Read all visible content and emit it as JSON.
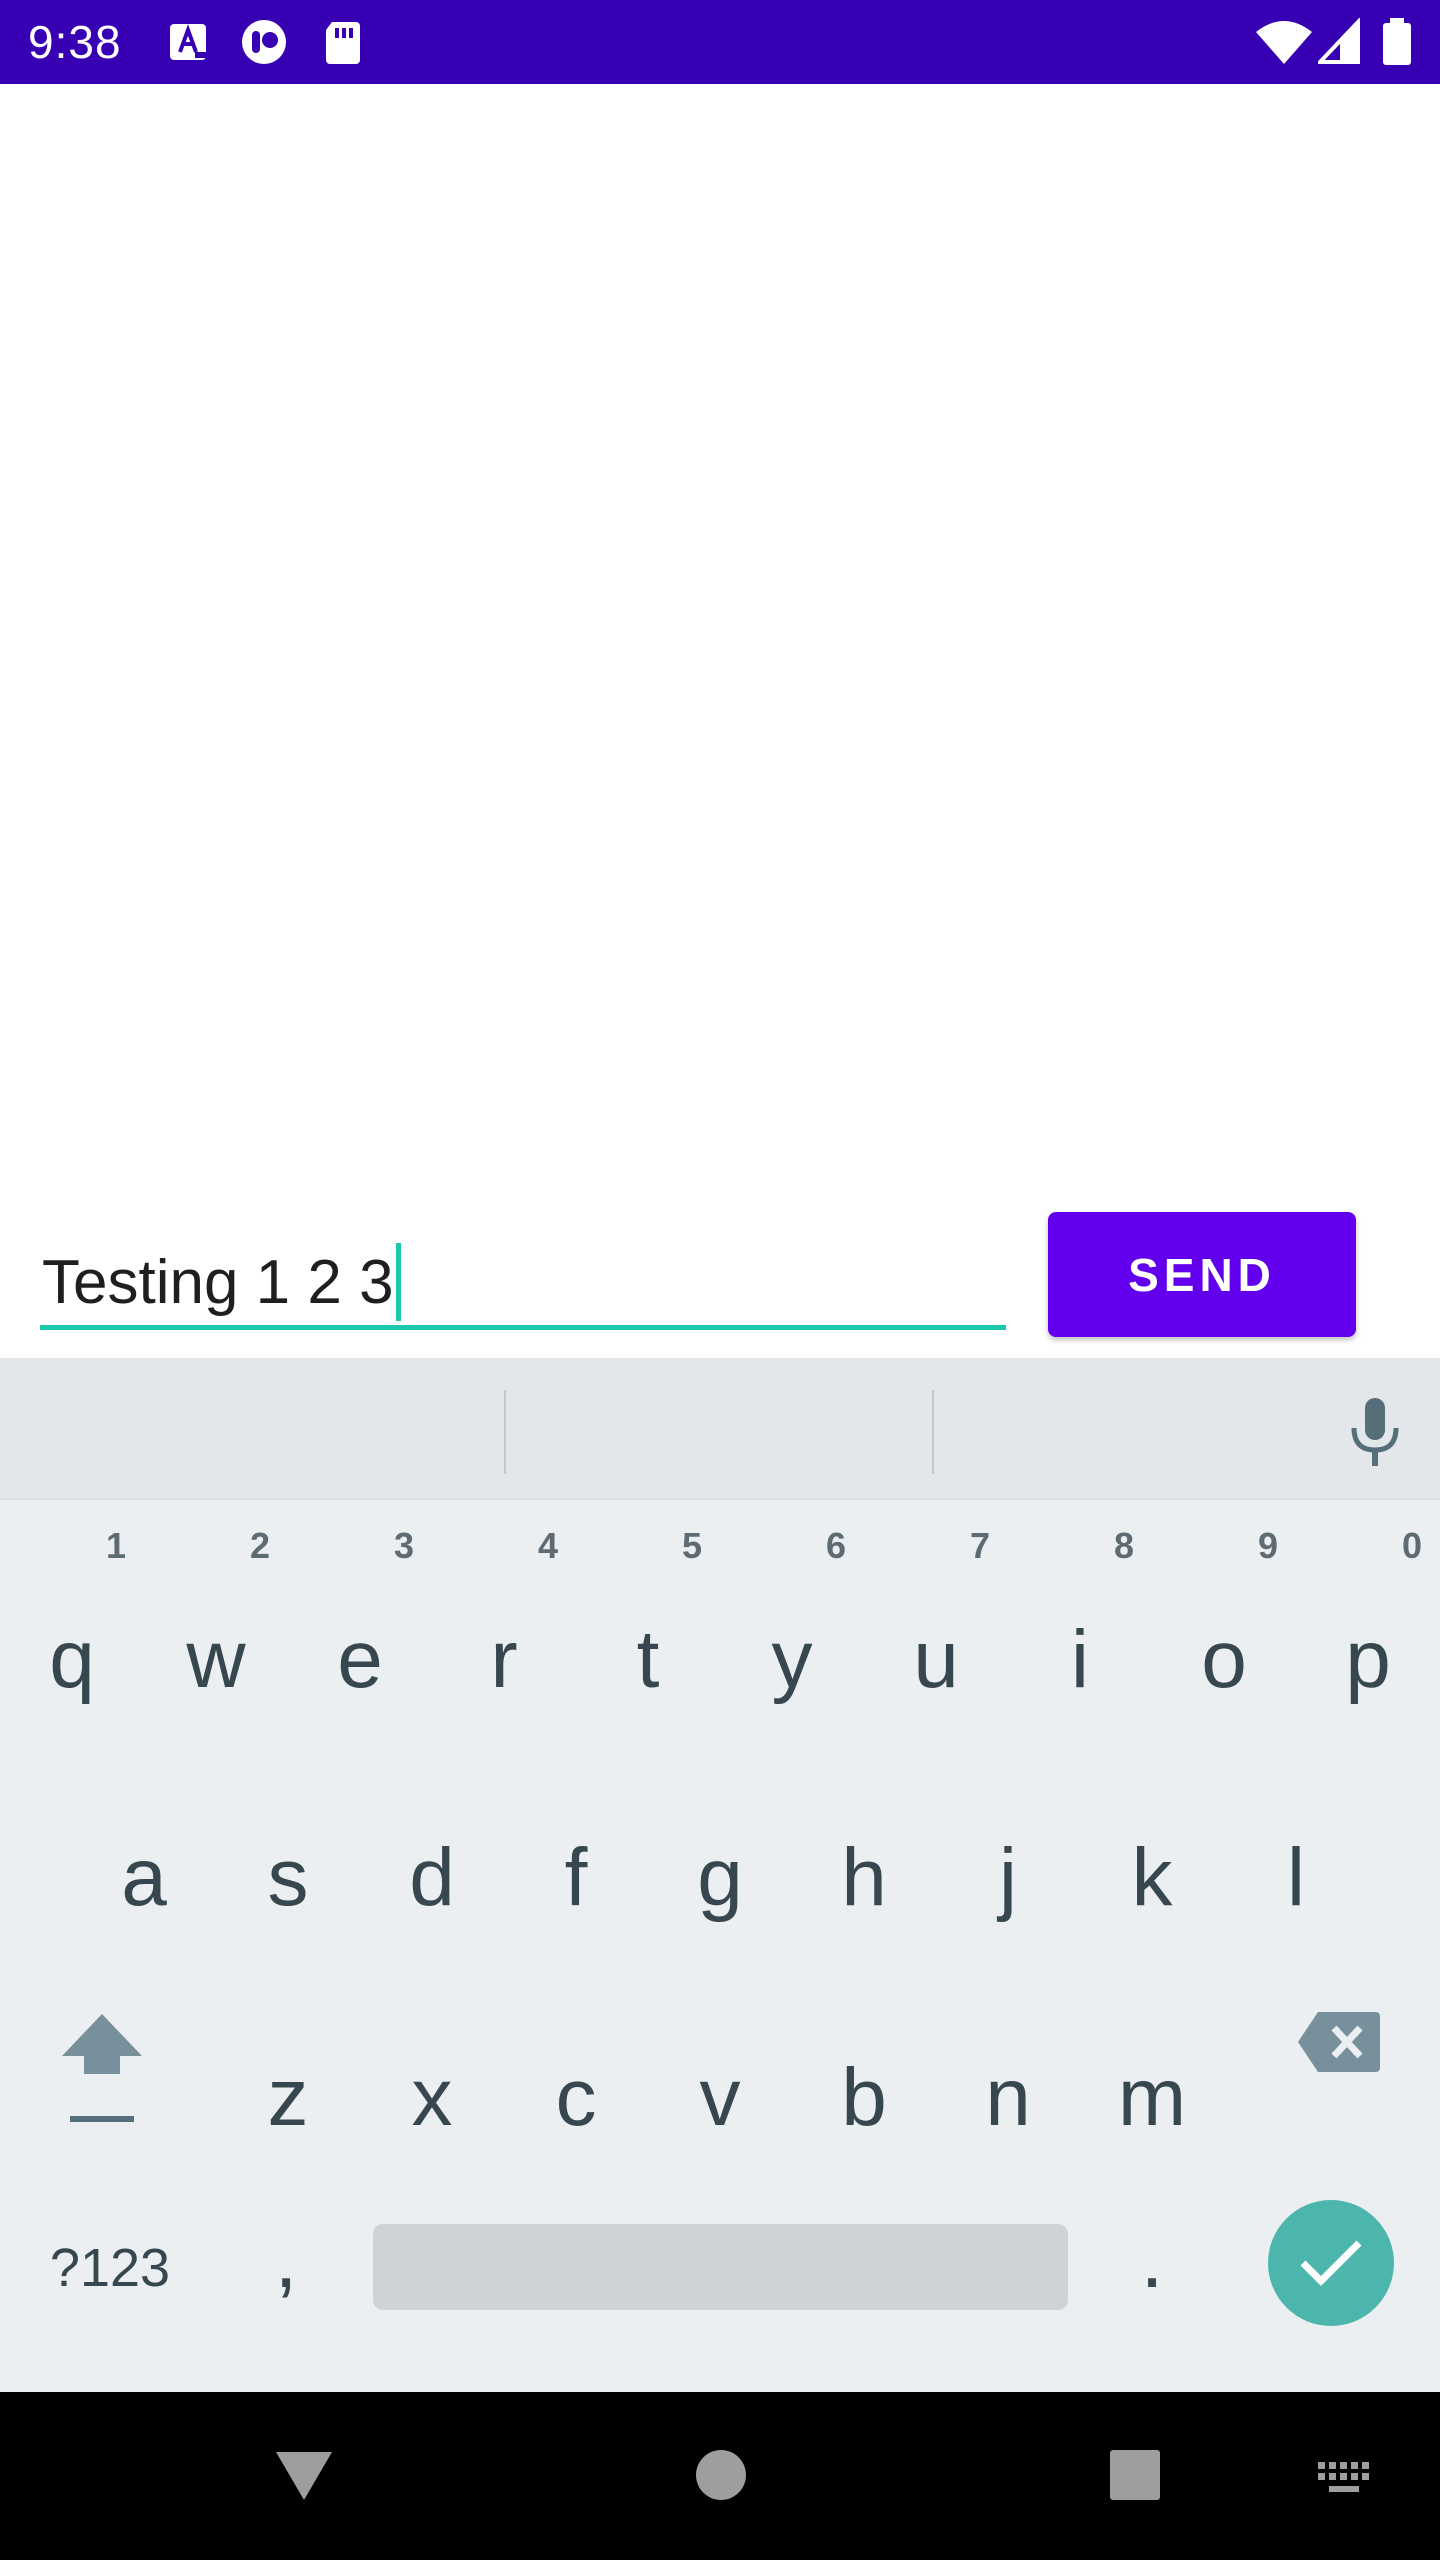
{
  "status_bar": {
    "time": "9:38",
    "left_icons": [
      "a-badge-icon",
      "toggle-app-icon",
      "sd-card-icon"
    ],
    "right_icons": [
      "wifi-icon",
      "signal-icon",
      "battery-icon"
    ],
    "background": "#3700b3"
  },
  "compose": {
    "input_value": "Testing 1 2 3",
    "accent": "#1bc7ad",
    "send_label": "SEND",
    "send_color": "#6200ee"
  },
  "keyboard": {
    "row1": [
      {
        "key": "q",
        "hint": "1"
      },
      {
        "key": "w",
        "hint": "2"
      },
      {
        "key": "e",
        "hint": "3"
      },
      {
        "key": "r",
        "hint": "4"
      },
      {
        "key": "t",
        "hint": "5"
      },
      {
        "key": "y",
        "hint": "6"
      },
      {
        "key": "u",
        "hint": "7"
      },
      {
        "key": "i",
        "hint": "8"
      },
      {
        "key": "o",
        "hint": "9"
      },
      {
        "key": "p",
        "hint": "0"
      }
    ],
    "row2": [
      "a",
      "s",
      "d",
      "f",
      "g",
      "h",
      "j",
      "k",
      "l"
    ],
    "row3": [
      "z",
      "x",
      "c",
      "v",
      "b",
      "n",
      "m"
    ],
    "symbols_label": "?123",
    "comma": ",",
    "period": ".",
    "enter_color": "#4db6ac"
  },
  "nav_bar": {
    "buttons": [
      "back-icon",
      "home-icon",
      "recents-icon",
      "keyboard-switch-icon"
    ]
  }
}
